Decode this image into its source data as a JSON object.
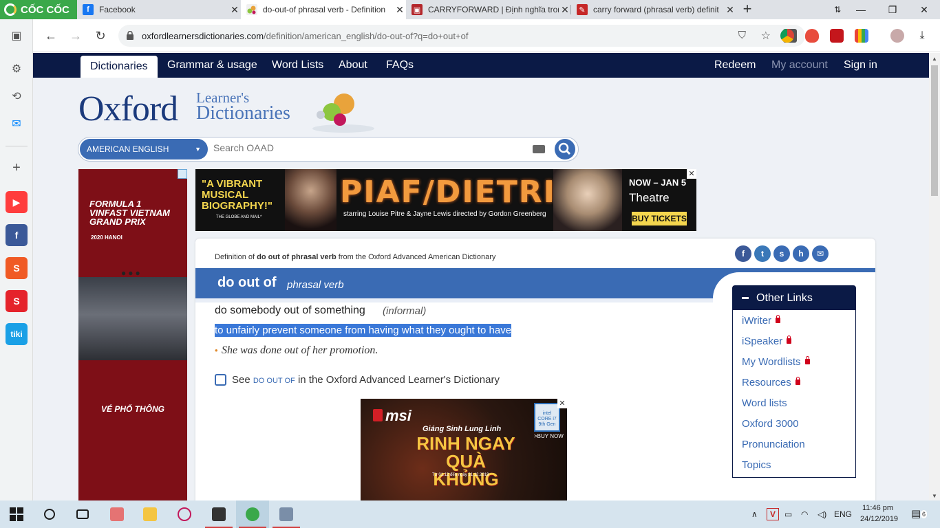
{
  "browser": {
    "tabs": [
      {
        "title": "Facebook",
        "active": false
      },
      {
        "title": "do-out-of phrasal verb - Definition",
        "active": true
      },
      {
        "title": "CARRYFORWARD | Định nghĩa tron",
        "active": false
      },
      {
        "title": "carry forward (phrasal verb) definit",
        "active": false
      }
    ],
    "brand_label": "CỐC CỐC",
    "close_glyph": "✕",
    "new_tab_glyph": "+",
    "window_controls": {
      "minimize": "—",
      "maximize": "❐",
      "close": "✕"
    },
    "url_domain": "oxfordlearnersdictionaries.com",
    "url_path": "/definition/american_english/do-out-of?q=do+out+of",
    "nav": {
      "back": "←",
      "forward": "→",
      "reload": "↻"
    }
  },
  "site_nav": {
    "items": [
      "Dictionaries",
      "Grammar & usage",
      "Word Lists",
      "About",
      "FAQs"
    ],
    "right_items": [
      "Redeem",
      "My account",
      "Sign in"
    ]
  },
  "logo": {
    "brand": "Oxford",
    "line1": "Learner's",
    "line2": "Dictionaries"
  },
  "search": {
    "language": "AMERICAN ENGLISH",
    "placeholder": "Search OAAD"
  },
  "ad_left": {
    "title": "FORMULA 1 VINFAST VIETNAM GRAND PRIX",
    "year": "2020 HANOI",
    "footer": "VÉ PHỔ THÔNG"
  },
  "ad_top": {
    "quote": "\"A VIBRANT MUSICAL BIOGRAPHY!\"",
    "quote_source": "THE GLOBE AND MAIL*",
    "title": "PIAF/DIETRICH",
    "credits": "starring Louise Pitre & Jayne Lewis   directed by Gordon Greenberg",
    "dates": "NOW – JAN 5",
    "theatre": "Theatre",
    "cta": "BUY TICKETS"
  },
  "entry": {
    "definition_of_prefix": "Definition of ",
    "definition_of_word": "do out of phrasal verb",
    "definition_of_suffix": " from the Oxford Advanced American Dictionary",
    "headword": "do out of",
    "pos": "phrasal verb",
    "phrase": "do somebody out of something",
    "register": "(informal)",
    "definition": "to unfairly prevent someone from having what they ought to have",
    "example": "She was done out of her promotion.",
    "see_prefix": "See ",
    "see_link": "DO OUT OF",
    "see_suffix": " in the Oxford Advanced Learner's Dictionary"
  },
  "share_icons": [
    "f",
    "t",
    "s",
    "h",
    "✉"
  ],
  "ad_inner": {
    "brand": "msi",
    "line1": "Giáng Sinh Lung Linh",
    "line2": "RINH NGAY QUÀ KHỦNG",
    "date": "Từ 01.12 đến ngày 31.12.2019",
    "cta": ">BUY NOW",
    "badge": "intel CORE i7 9th Gen"
  },
  "other_links": {
    "heading": "Other Links",
    "items": [
      {
        "label": "iWriter",
        "locked": true
      },
      {
        "label": "iSpeaker",
        "locked": true
      },
      {
        "label": "My Wordlists",
        "locked": true
      },
      {
        "label": "Resources",
        "locked": true
      },
      {
        "label": "Word lists",
        "locked": false
      },
      {
        "label": "Oxford 3000",
        "locked": false
      },
      {
        "label": "Pronunciation",
        "locked": false
      },
      {
        "label": "Topics",
        "locked": false
      }
    ]
  },
  "taskbar": {
    "language": "ENG",
    "time": "11:46 pm",
    "date": "24/12/2019",
    "notification_count": "6"
  },
  "colors": {
    "nav_bg": "#0b1a46",
    "accent_blue": "#3a6bb4",
    "selection": "#3a78d8",
    "coccoc_green": "#3aa84a"
  }
}
